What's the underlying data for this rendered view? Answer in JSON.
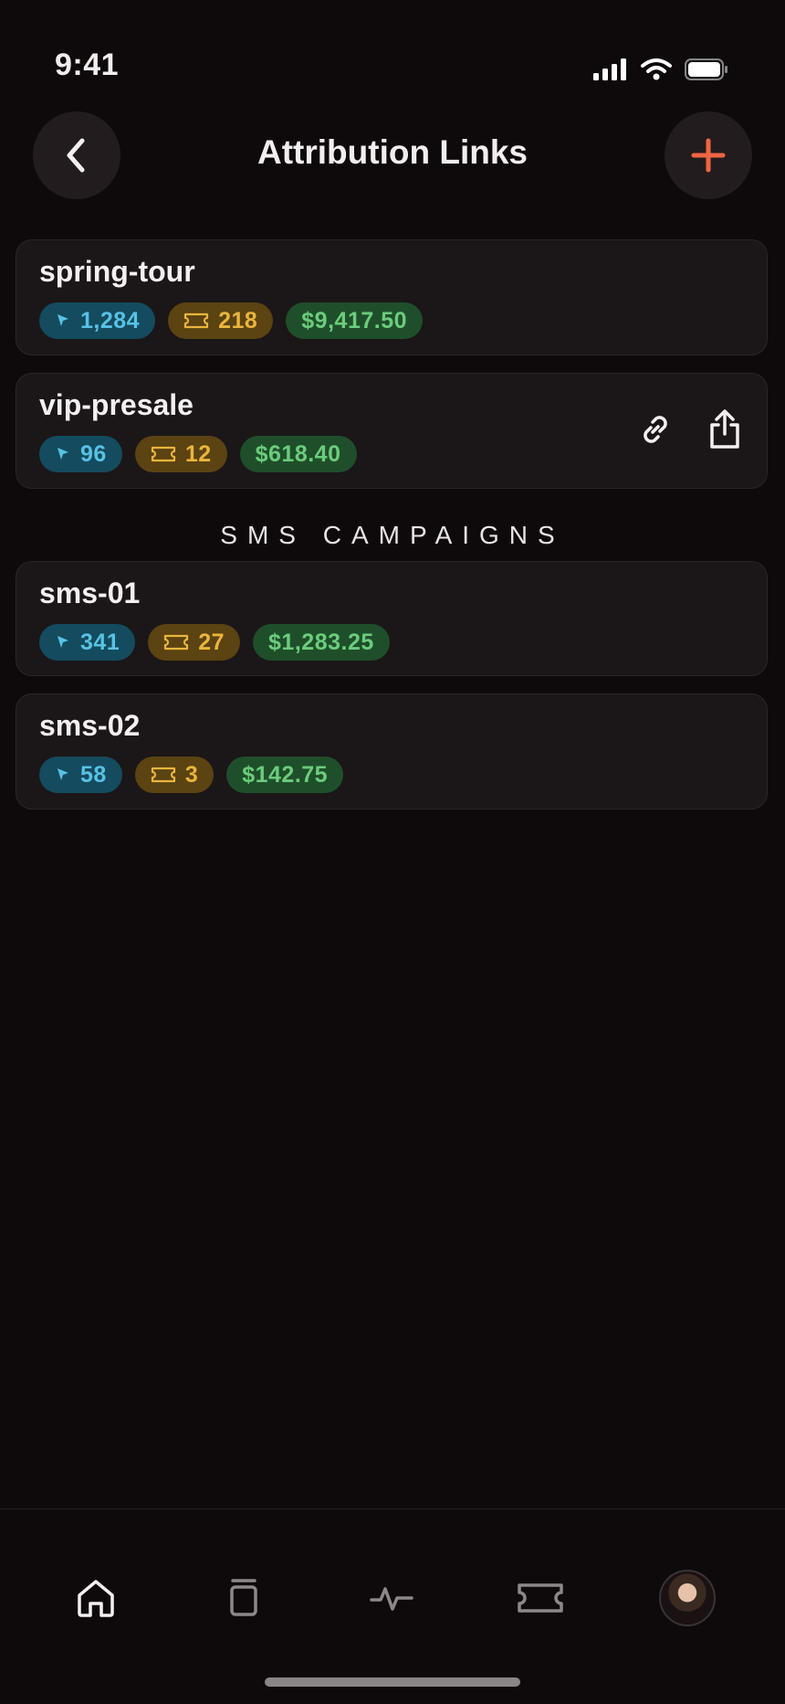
{
  "status_bar": {
    "time": "9:41",
    "icons": [
      "signal-icon",
      "wifi-icon",
      "battery-icon"
    ]
  },
  "header": {
    "title": "Attribution Links",
    "back_icon": "chevron-left-icon",
    "add_icon": "plus-icon"
  },
  "links": [
    {
      "name": "spring-tour",
      "clicks": "1,284",
      "tickets": "218",
      "revenue": "$9,417.50",
      "show_actions": false
    },
    {
      "name": "vip-presale",
      "clicks": "96",
      "tickets": "12",
      "revenue": "$618.40",
      "show_actions": true
    }
  ],
  "sms_section": {
    "title": "SMS CAMPAIGNS",
    "links": [
      {
        "name": "sms-01",
        "clicks": "341",
        "tickets": "27",
        "revenue": "$1,283.25"
      },
      {
        "name": "sms-02",
        "clicks": "58",
        "tickets": "3",
        "revenue": "$142.75"
      }
    ]
  },
  "tab_bar": {
    "tabs": [
      "home-icon",
      "pages-icon",
      "activity-icon",
      "ticket-icon",
      "profile-avatar"
    ]
  },
  "colors": {
    "background": "#0e0a0c",
    "accent": "#f06542",
    "clicks": "#58c2e4",
    "tickets": "#eab53c",
    "revenue": "#6ccc7c"
  }
}
